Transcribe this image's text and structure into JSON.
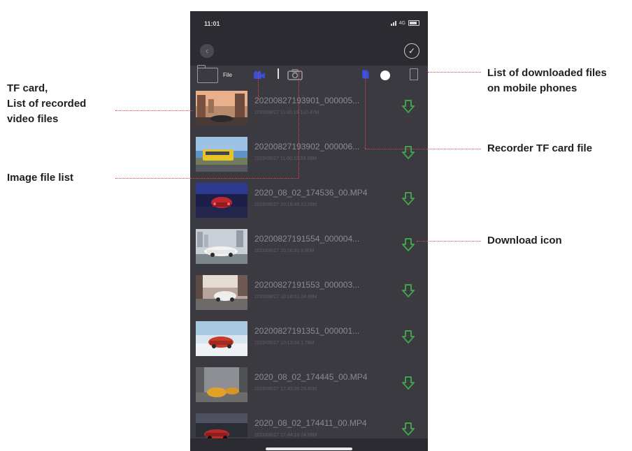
{
  "status_bar": {
    "time": "11:01",
    "network": "4G"
  },
  "toolbar": {
    "file_label": "File"
  },
  "files": [
    {
      "name": "20200827193901_000005...",
      "meta": "2020/08/27 11:00:18    110.47M",
      "thumb": "city"
    },
    {
      "name": "20200827193902_000006...",
      "meta": "2020/08/27 11:00:15    69.58M",
      "thumb": "bus"
    },
    {
      "name": "2020_08_02_174536_00.MP4",
      "meta": "2020/08/27 10:18:48    22.09M",
      "thumb": "red-night"
    },
    {
      "name": "20200827191554_000004...",
      "meta": "2020/08/27 10:16:02    8.80M",
      "thumb": "white-car"
    },
    {
      "name": "20200827191553_000003...",
      "meta": "2020/08/27 10:16:01    24.89M",
      "thumb": "white-car-road"
    },
    {
      "name": "20200827191351_000001...",
      "meta": "2020/08/27 10:13:54    1.78M",
      "thumb": "red-car-snow"
    },
    {
      "name": "2020_08_02_174445_00.MP4",
      "meta": "2020/08/27 17:43:26    25.80M",
      "thumb": "yellow-cars"
    },
    {
      "name": "2020_08_02_174411_00.MP4",
      "meta": "2020/08/27 17:44:18    24.69M",
      "thumb": "red-car-dark"
    }
  ],
  "annotations": {
    "tf_card": "TF card,\nList of recorded\nvideo files",
    "image_list": "Image file list",
    "downloaded_files": "List of downloaded files\non mobile phones",
    "recorder_tf": "Recorder TF card file",
    "download_icon": "Download icon"
  },
  "colors": {
    "background": "#3b3a41",
    "bar": "#2c2b31",
    "accent_blue": "#3a4fd8",
    "download_green": "#3fa24a",
    "callout_red": "#e24848"
  }
}
